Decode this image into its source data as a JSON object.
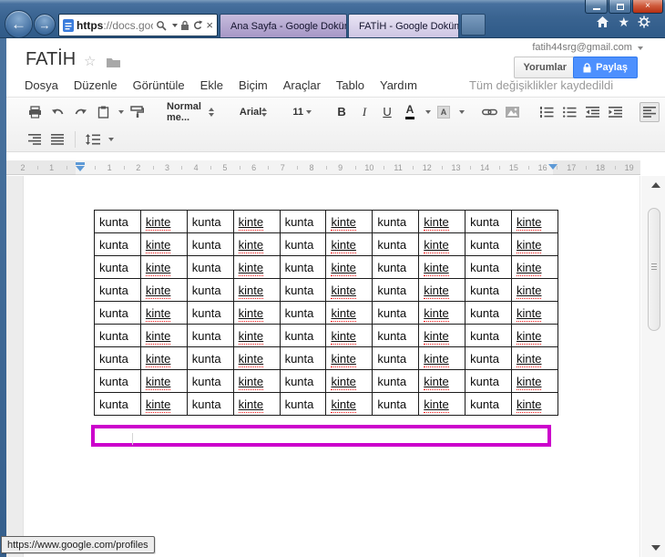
{
  "browser": {
    "address_bar": {
      "url_scheme": "https",
      "url_rest": "://docs.goo..."
    },
    "tabs": [
      {
        "title": "Ana Sayfa - Google Dokümanlar",
        "active": false
      },
      {
        "title": "FATİH - Google Dokümanlar",
        "active": true,
        "close_glyph": "×"
      }
    ],
    "window_controls": {
      "close_glyph": "×"
    },
    "favorites_star_glyph": "★"
  },
  "docs": {
    "account_email": "fatih44srg@gmail.com",
    "doc_title": "FATİH",
    "title_star_glyph": "☆",
    "comments_button": "Yorumlar",
    "share_button": "Paylaş",
    "share_button_color": "#4d90fe",
    "menus": [
      "Dosya",
      "Düzenle",
      "Görüntüle",
      "Ekle",
      "Biçim",
      "Araçlar",
      "Tablo",
      "Yardım"
    ],
    "save_status": "Tüm değişiklikler kaydedildi",
    "toolbar": {
      "style_dropdown": "Normal me...",
      "font_dropdown": "Arial",
      "font_size": "11",
      "bold": "B",
      "italic": "I",
      "underline": "U",
      "text_color_letter": "A",
      "highlight_letter": "A"
    },
    "ruler_labels": [
      "2",
      "1",
      "1",
      "2",
      "3",
      "4",
      "5",
      "6",
      "7",
      "8",
      "9",
      "10",
      "11",
      "12",
      "13",
      "14",
      "15",
      "16",
      "17",
      "18",
      "19"
    ]
  },
  "document": {
    "table": {
      "rows": 9,
      "columns": 10,
      "pattern": [
        "kunta",
        "kinte"
      ]
    },
    "selection_border_color": "#cc00cc"
  },
  "status_tooltip": "https://www.google.com/profiles"
}
